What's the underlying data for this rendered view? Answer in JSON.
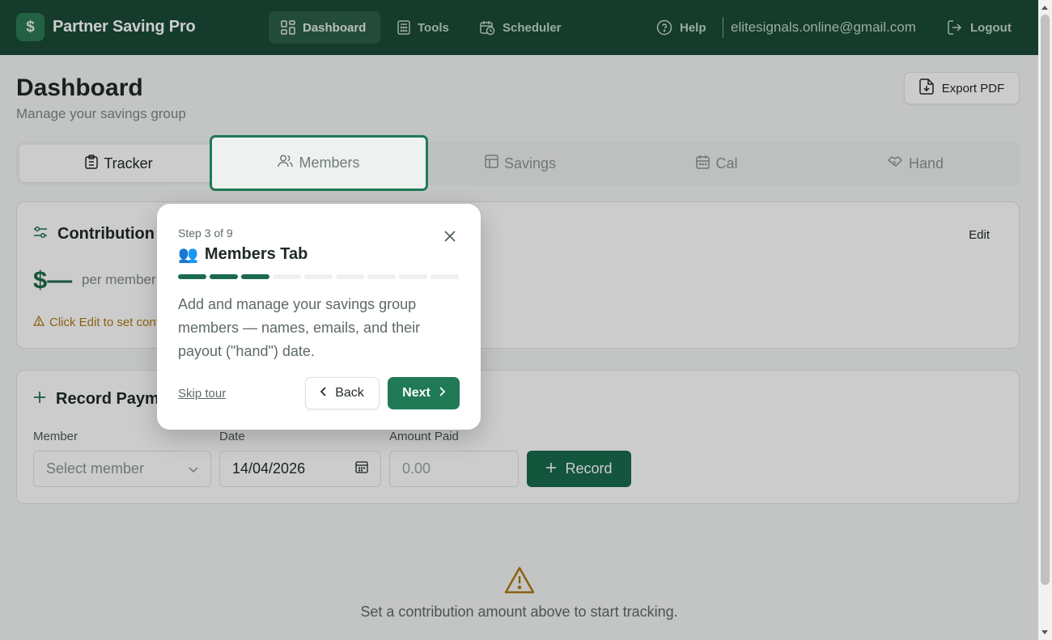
{
  "nav": {
    "brand_name": "Partner Saving Pro",
    "brand_symbol": "$",
    "items": [
      {
        "label": "Dashboard",
        "icon": "layout-grid-icon"
      },
      {
        "label": "Tools",
        "icon": "calculator-icon"
      },
      {
        "label": "Scheduler",
        "icon": "calendar-clock-icon"
      }
    ],
    "help_label": "Help",
    "user_email": "elitesignals.online@gmail.com",
    "logout_label": "Logout"
  },
  "page": {
    "title": "Dashboard",
    "subtitle": "Manage your savings group",
    "export_label": "Export PDF"
  },
  "tabs": [
    {
      "label": "Tracker",
      "icon": "clipboard-icon"
    },
    {
      "label": "Members",
      "icon": "users-icon"
    },
    {
      "label": "Savings",
      "icon": "table-icon"
    },
    {
      "label": "Cal",
      "icon": "calendar-icon"
    },
    {
      "label": "Hand",
      "icon": "handshake-icon"
    }
  ],
  "contribution": {
    "title": "Contribution",
    "edit_label": "Edit",
    "amount": "$—",
    "per_label": "per member",
    "warning": "Click Edit to set contribution"
  },
  "record_payment": {
    "title": "Record Payment",
    "member_label": "Member",
    "member_placeholder": "Select member",
    "date_label": "Date",
    "date_value": "14/04/2026",
    "amount_label": "Amount Paid",
    "amount_placeholder": "0.00",
    "record_label": "Record"
  },
  "empty_state": {
    "text": "Set a contribution amount above to start tracking."
  },
  "tour": {
    "step_text": "Step 3 of 9",
    "title": "Members Tab",
    "title_emoji": "👥",
    "current_step": 3,
    "total_steps": 9,
    "body": "Add and manage your savings group members — names, emails, and their payout (\"hand\") date.",
    "skip_label": "Skip tour",
    "back_label": "Back",
    "next_label": "Next"
  },
  "colors": {
    "nav_bg": "#1a4a36",
    "accent": "#1f7a55",
    "warning": "#b07a14"
  }
}
